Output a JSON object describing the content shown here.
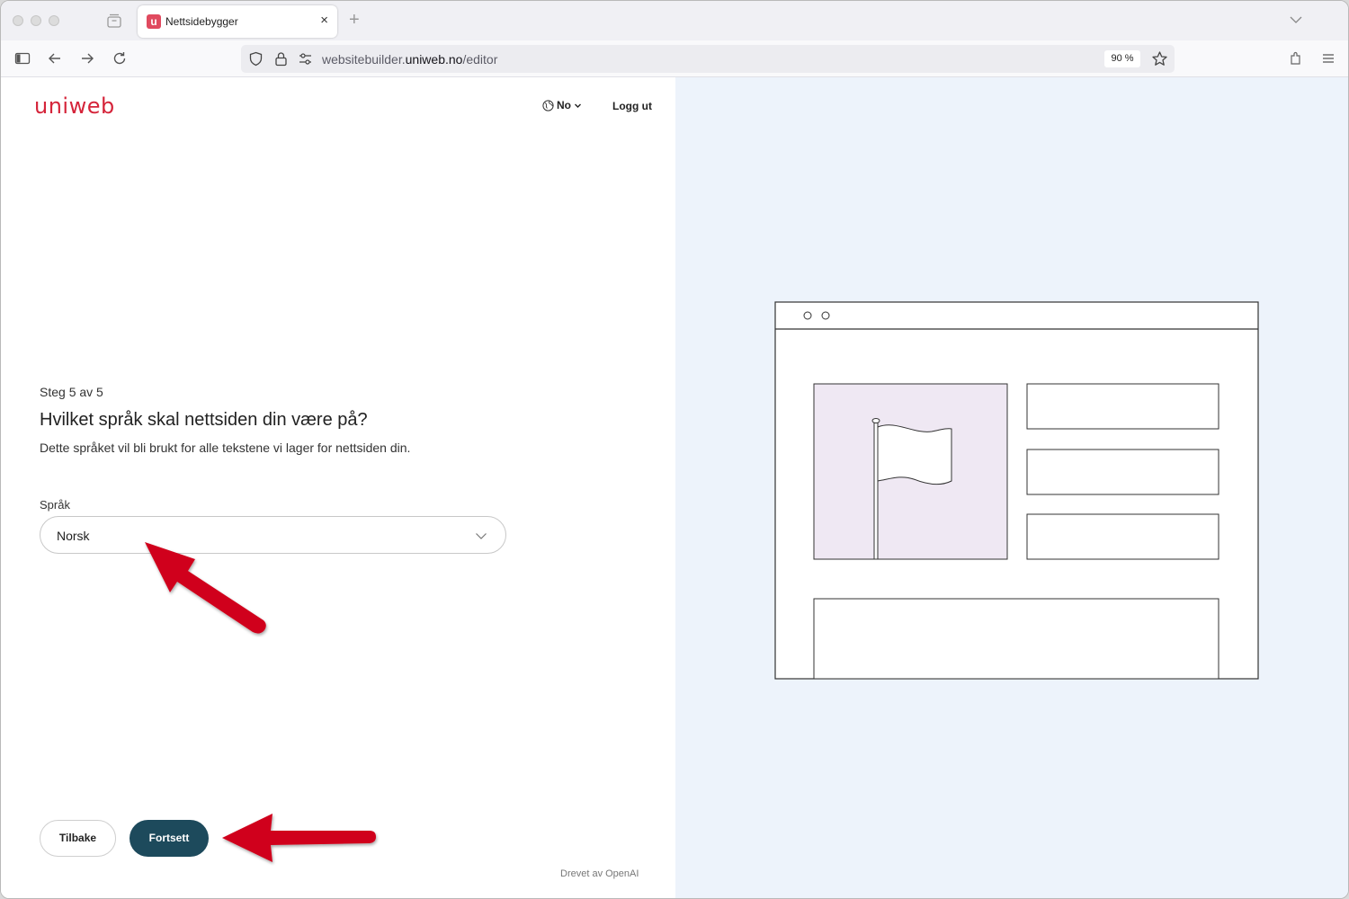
{
  "browser": {
    "tab_title": "Nettsidebygger",
    "tab_favicon_letter": "u",
    "tab_close": "×",
    "new_tab": "+",
    "url_prefix": "websitebuilder.",
    "url_domain": "uniweb.no",
    "url_path": "/editor",
    "zoom": "90 %"
  },
  "header": {
    "logo": "uniweb",
    "language_code": "No",
    "logout_label": "Logg ut"
  },
  "step": {
    "indicator": "Steg 5 av 5",
    "title": "Hvilket språk skal nettsiden din være på?",
    "description": "Dette språket vil bli brukt for alle tekstene vi lager for nettsiden din."
  },
  "form": {
    "language_label": "Språk",
    "language_value": "Norsk"
  },
  "actions": {
    "back_label": "Tilbake",
    "continue_label": "Fortsett"
  },
  "footer": {
    "powered_by": "Drevet av OpenAI"
  },
  "colors": {
    "brand_red": "#d5243a",
    "primary_button": "#1d4a5c",
    "preview_bg": "#edf3fb",
    "image_placeholder": "#efe8f3",
    "annotation_arrow": "#d0021b"
  }
}
